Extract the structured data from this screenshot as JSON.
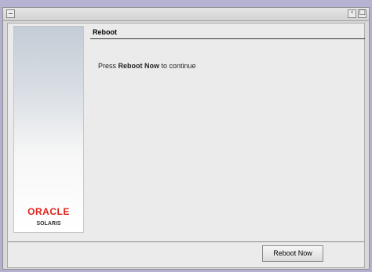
{
  "window": {
    "controls": {
      "left": "window-menu",
      "right_1": "‹",
      "right_2": "□"
    }
  },
  "sidebar": {
    "brand_name": "ORACLE",
    "brand_product": "SOLARIS",
    "brand_color": "#e0201a"
  },
  "main": {
    "heading": "Reboot",
    "message_prefix": "Press ",
    "message_emphasis": "Reboot Now",
    "message_suffix": " to continue"
  },
  "footer": {
    "reboot_button_label": "Reboot Now"
  }
}
